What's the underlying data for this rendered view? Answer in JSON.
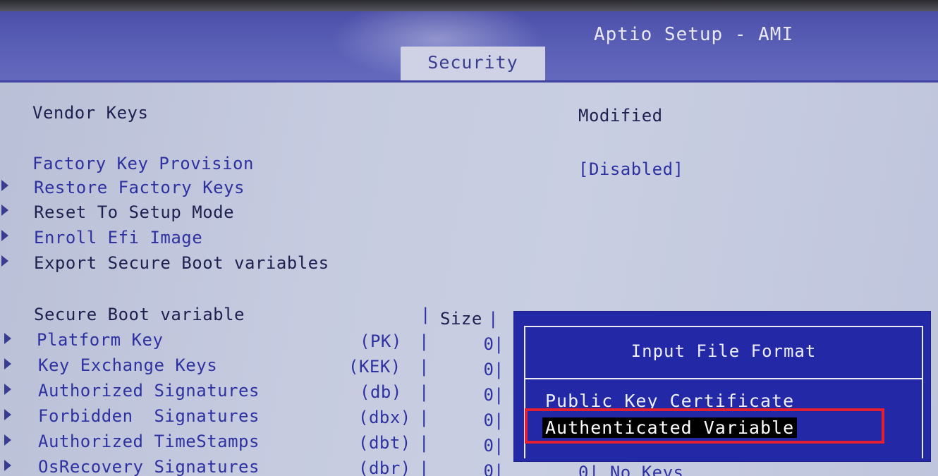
{
  "header": {
    "title": "Aptio Setup - AMI",
    "active_tab": "Security"
  },
  "vendor_keys": {
    "label": "Vendor Keys",
    "value": "Modified"
  },
  "factory_key_provision": {
    "label": "Factory Key Provision",
    "value": "[Disabled]"
  },
  "menu_items": [
    {
      "label": "Restore Factory Keys"
    },
    {
      "label": "Reset To Setup Mode"
    },
    {
      "label": "Enroll Efi Image"
    },
    {
      "label": "Export Secure Boot variables"
    }
  ],
  "table": {
    "header_label": "Secure Boot variable",
    "size_label": "Size",
    "rows": [
      {
        "name": "Platform Key",
        "abbr": "(PK)",
        "size": "0"
      },
      {
        "name": "Key Exchange Keys",
        "abbr": "(KEK)",
        "size": "0"
      },
      {
        "name": "Authorized Signatures",
        "abbr": "(db)",
        "size": "0"
      },
      {
        "name": "Forbidden  Signatures",
        "abbr": "(dbx)",
        "size": "0"
      },
      {
        "name": "Authorized TimeStamps",
        "abbr": "(dbt)",
        "size": "0"
      },
      {
        "name": "OsRecovery Signatures",
        "abbr": "(dbr)",
        "size": "0"
      }
    ],
    "last_row_extra": "0| No Keys"
  },
  "popup": {
    "title": "Input File Format",
    "options": [
      "Public Key Certificate",
      "Authenticated Variable"
    ],
    "selected_index": 1
  },
  "colors": {
    "header_bg": "#4c4fa8",
    "popup_bg": "#2228a6",
    "highlight_box": "#e0202e",
    "text_blue": "#2e31a0"
  }
}
